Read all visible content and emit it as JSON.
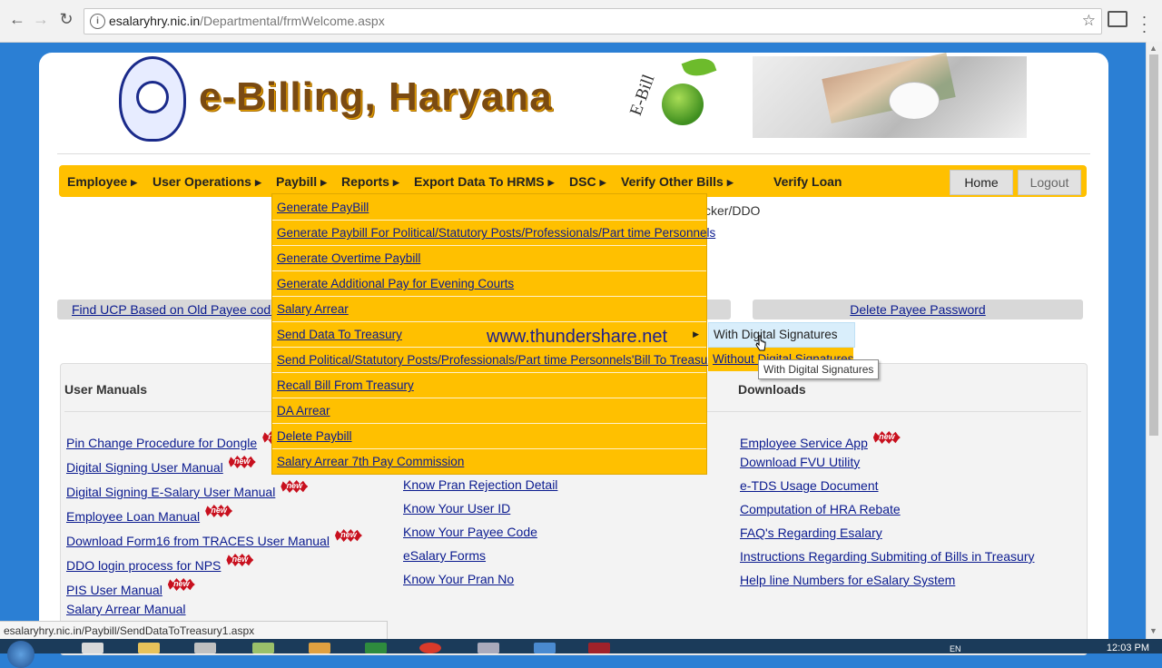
{
  "browser": {
    "url_host": "esalaryhry.nic.in",
    "url_path": "/Departmental/frmWelcome.aspx",
    "status_url": "esalaryhry.nic.in/Paybill/SendDataToTreasury1.aspx"
  },
  "header": {
    "brand_title": "e-Billing, Haryana",
    "ebill_logo_text": "E-Bill"
  },
  "menu": {
    "items": [
      "Employee",
      "User Operations",
      "Paybill",
      "Reports",
      "Export Data To HRMS",
      "DSC",
      "Verify Other Bills",
      "Verify Loan"
    ],
    "home": "Home",
    "logout": "Logout"
  },
  "cropped_text": "cker/DDO",
  "links_bar": {
    "left": "Find UCP Based on Old Payee code ,",
    "right": "Delete Payee Password"
  },
  "paybill_dropdown": [
    "Generate PayBill",
    "Generate Paybill For Political/Statutory Posts/Professionals/Part time Personnels",
    "Generate Overtime Paybill",
    "Generate Additional Pay for Evening Courts",
    "Salary Arrear",
    "Send Data To Treasury",
    "Send Political/Statutory Posts/Professionals/Part time Personnels'Bill To Treasury",
    "Recall Bill From Treasury",
    "DA Arrear",
    "Delete Paybill",
    "Salary Arrear 7th Pay Commission"
  ],
  "watermark": "www.thundershare.net",
  "submenu": {
    "with": "With Digital Signatures",
    "without": "Without Digital Signatures",
    "tooltip": "With Digital Signatures"
  },
  "badge_text": "new",
  "panel": {
    "user_manuals_title": "User Manuals",
    "downloads_title": "Downloads",
    "user_manuals": [
      {
        "label": "Pin Change Procedure for Dongle",
        "new": true
      },
      {
        "label": "Digital Signing User Manual",
        "new": true
      },
      {
        "label": "Digital Signing E-Salary User Manual",
        "new": true
      },
      {
        "label": "Employee Loan Manual",
        "new": true
      },
      {
        "label": "Download Form16 from TRACES User Manual",
        "new": true
      },
      {
        "label": "DDO login process for NPS",
        "new": true
      },
      {
        "label": "PIS User Manual",
        "new": true
      },
      {
        "label": "Salary Arrear Manual",
        "new": false
      }
    ],
    "middle": [
      "Know Pran Rejection Detail",
      "Know Your User ID",
      "Know Your Payee Code",
      "eSalary Forms",
      "Know Your Pran No"
    ],
    "downloads": [
      {
        "label": "Employee Service App",
        "new": true
      },
      {
        "label": "Download FVU Utility",
        "new": false
      },
      {
        "label": "e-TDS Usage Document",
        "new": false
      },
      {
        "label": "Computation of HRA Rebate",
        "new": false
      },
      {
        "label": "FAQ's Regarding Esalary",
        "new": false
      },
      {
        "label": "Instructions Regarding Submiting of Bills in Treasury",
        "new": false
      },
      {
        "label": "Help line Numbers for eSalary System",
        "new": false
      }
    ]
  },
  "taskbar": {
    "clock": "12:03 PM",
    "lang": "EN"
  },
  "colors": {
    "menu_bg": "#ffc000",
    "link": "#0a1a8f",
    "page_bg": "#2b7fd4",
    "badge_red": "#c8101e"
  }
}
